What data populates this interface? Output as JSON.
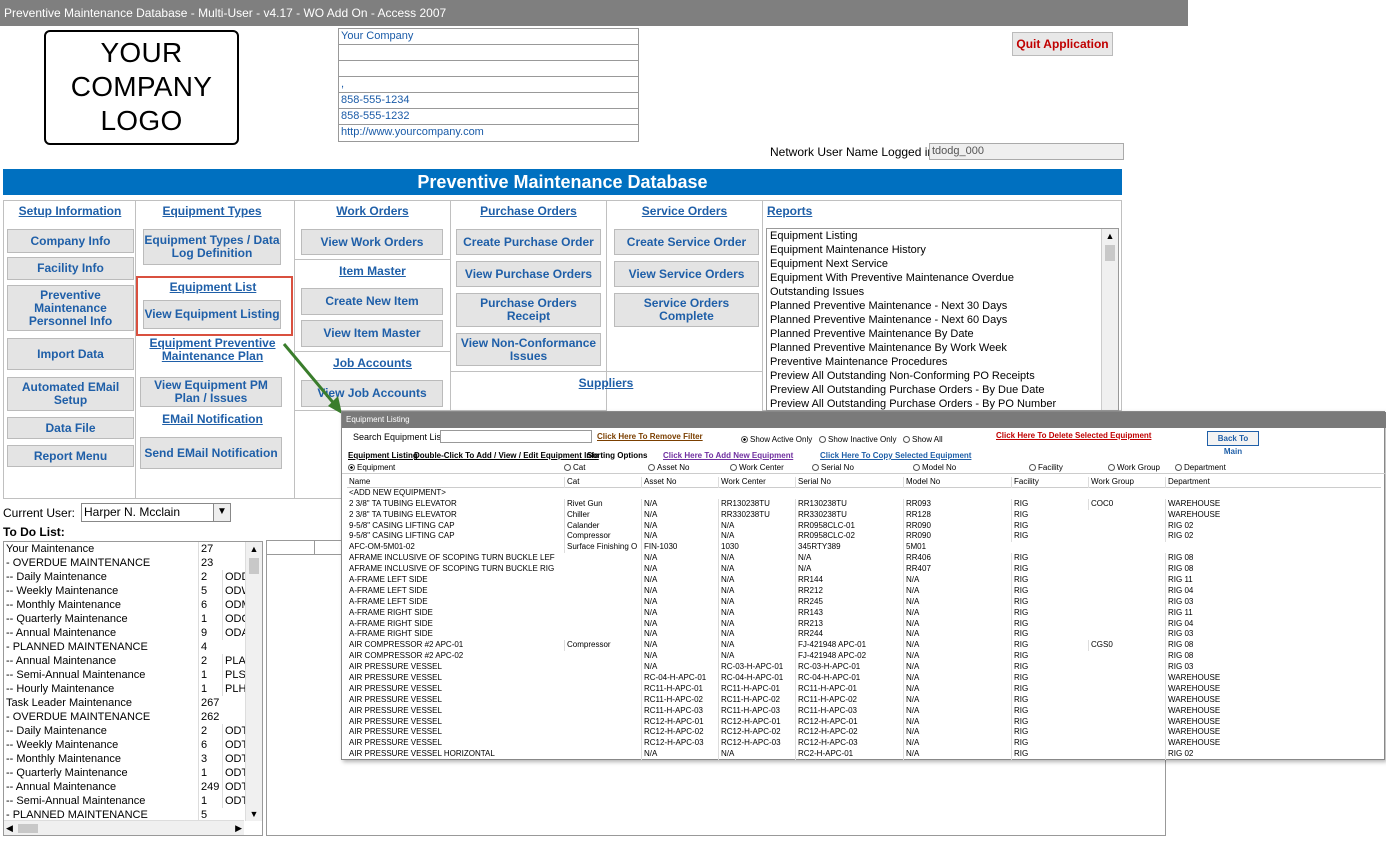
{
  "window_title": "Preventive Maintenance Database - Multi-User - v4.17 - WO Add On - Access 2007",
  "logo": {
    "line1": "YOUR",
    "line2": "COMPANY",
    "line3": "LOGO"
  },
  "company_info": [
    "Your Company",
    "",
    "",
    ",",
    "858-555-1234",
    "858-555-1232",
    "http://www.yourcompany.com"
  ],
  "quit_label": "Quit Application",
  "network_user": {
    "label": "Network User Name Logged in is",
    "value": "tdodg_000"
  },
  "banner": "Preventive Maintenance Database",
  "setup": {
    "header": "Setup Information",
    "buttons": [
      "Company Info",
      "Facility Info",
      "Preventive Maintenance Personnel Info",
      "Import Data",
      "Automated EMail Setup",
      "Data File",
      "Report Menu"
    ]
  },
  "equip_types": {
    "header": "Equipment Types",
    "button": "Equipment Types / Data Log Definition"
  },
  "equip_list": {
    "header": "Equipment List",
    "button": "View Equipment Listing"
  },
  "equip_pm": {
    "header": "Equipment Preventive Maintenance Plan",
    "button": "View Equipment PM Plan / Issues"
  },
  "email_notif": {
    "header": "EMail Notification",
    "button": "Send EMail Notification"
  },
  "work_orders": {
    "header": "Work Orders",
    "button": "View Work Orders"
  },
  "item_master": {
    "header": "Item Master",
    "create": "Create New Item",
    "view": "View Item Master"
  },
  "job_accounts": {
    "header": "Job Accounts",
    "button": "View Job Accounts"
  },
  "purchase_orders": {
    "header": "Purchase Orders",
    "buttons": [
      "Create Purchase Order",
      "View Purchase Orders",
      "Purchase Orders Receipt",
      "View Non-Conformance Issues"
    ]
  },
  "suppliers": {
    "header": "Suppliers"
  },
  "service_orders": {
    "header": "Service Orders",
    "buttons": [
      "Create Service Order",
      "View Service Orders",
      "Service Orders Complete"
    ]
  },
  "reports": {
    "header": "Reports",
    "items": [
      "Equipment Listing",
      "Equipment Maintenance History",
      "Equipment Next Service",
      "Equipment With Preventive Maintenance Overdue",
      "Outstanding Issues",
      "Planned Preventive Maintenance - Next 30 Days",
      "Planned Preventive Maintenance - Next 60 Days",
      "Planned Preventive Maintenance By Date",
      "Planned Preventive Maintenance By Work Week",
      "Preventive Maintenance Procedures",
      "Preview All Outstanding Non-Conforming PO Receipts",
      "Preview All Outstanding Purchase Orders - By Due Date",
      "Preview All Outstanding Purchase Orders - By PO Number"
    ]
  },
  "current_user": {
    "label": "Current User:",
    "value": "Harper N. Mcclain"
  },
  "todo": {
    "label": "To Do List:",
    "rows": [
      [
        "Your Maintenance",
        "27",
        ""
      ],
      [
        " - OVERDUE MAINTENANCE",
        "23",
        ""
      ],
      [
        " -- Daily Maintenance",
        "2",
        "ODD"
      ],
      [
        " -- Weekly Maintenance",
        "5",
        "ODW"
      ],
      [
        " -- Monthly Maintenance",
        "6",
        "ODM"
      ],
      [
        " -- Quarterly Maintenance",
        "1",
        "ODQ"
      ],
      [
        " -- Annual Maintenance",
        "9",
        "ODA"
      ],
      [
        " - PLANNED MAINTENANCE",
        "4",
        ""
      ],
      [
        " -- Annual Maintenance",
        "2",
        "PLAI"
      ],
      [
        " -- Semi-Annual Maintenance",
        "1",
        "PLSe"
      ],
      [
        " -- Hourly Maintenance",
        "1",
        "PLHo"
      ],
      [
        "Task Leader Maintenance",
        "267",
        ""
      ],
      [
        " - OVERDUE MAINTENANCE",
        "262",
        ""
      ],
      [
        " -- Daily Maintenance",
        "2",
        "ODT"
      ],
      [
        " -- Weekly Maintenance",
        "6",
        "ODT"
      ],
      [
        " -- Monthly Maintenance",
        "3",
        "ODT"
      ],
      [
        " -- Quarterly Maintenance",
        "1",
        "ODT"
      ],
      [
        " -- Annual Maintenance",
        "249",
        "ODT"
      ],
      [
        " -- Semi-Annual Maintenance",
        "1",
        "ODT"
      ],
      [
        " - PLANNED MAINTENANCE",
        "5",
        ""
      ]
    ]
  },
  "equipment_window": {
    "title": "Equipment Listing",
    "search_label": "Search Equipment List",
    "remove_filter": "Click Here To Remove Filter",
    "radio_active": "Show Active Only",
    "radio_inactive": "Show Inactive Only",
    "radio_all": "Show All",
    "delete_link": "Click Here To Delete Selected Equipment",
    "back_label": "Back To Main",
    "instructions_a": "Equipment Listing",
    "instructions_b": "Double-Click To Add / View / Edit Equipment Info",
    "sorting_label": "Sorting Options",
    "add_link": "Click Here To Add New Equipment",
    "copy_link": "Click Here To Copy Selected Equipment",
    "sort_options": [
      "Equipment",
      "Cat",
      "Asset No",
      "Work Center",
      "Serial No",
      "Model No",
      "Facility",
      "Work Group",
      "Department"
    ],
    "columns": [
      "Name",
      "Cat",
      "Asset No",
      "Work Center",
      "Serial No",
      "Model No",
      "Facility",
      "Work Group",
      "Department"
    ],
    "rows": [
      [
        "<ADD NEW EQUIPMENT>",
        "",
        "",
        "",
        "",
        "",
        "",
        "",
        ""
      ],
      [
        "2 3/8\" TA TUBING ELEVATOR",
        "Rivet Gun",
        "N/A",
        "RR130238TU",
        "RR130238TU",
        "RR093",
        "RIG",
        "COC0",
        "WAREHOUSE"
      ],
      [
        "2 3/8\" TA TUBING ELEVATOR",
        "Chiller",
        "N/A",
        "RR330238TU",
        "RR330238TU",
        "RR128",
        "RIG",
        "",
        "WAREHOUSE"
      ],
      [
        "9-5/8\" CASING LIFTING CAP",
        "Calander",
        "N/A",
        "N/A",
        "RR0958CLC-01",
        "RR090",
        "RIG",
        "",
        "RIG 02"
      ],
      [
        "9-5/8\" CASING LIFTING CAP",
        "Compressor",
        "N/A",
        "N/A",
        "RR0958CLC-02",
        "RR090",
        "RIG",
        "",
        "RIG 02"
      ],
      [
        "AFC-OM-5M01-02",
        "Surface Finishing O",
        "FIN-1030",
        "1030",
        "345RTY389",
        "5M01",
        "",
        "",
        ""
      ],
      [
        "AFRAME INCLUSIVE OF SCOPING TURN BUCKLE LEF",
        "",
        "N/A",
        "N/A",
        "N/A",
        "RR406",
        "RIG",
        "",
        "RIG 08"
      ],
      [
        "AFRAME INCLUSIVE OF SCOPING TURN BUCKLE RIG",
        "",
        "N/A",
        "N/A",
        "N/A",
        "RR407",
        "RIG",
        "",
        "RIG 08"
      ],
      [
        "A-FRAME LEFT SIDE",
        "",
        "N/A",
        "N/A",
        "RR144",
        "N/A",
        "RIG",
        "",
        "RIG 11"
      ],
      [
        "A-FRAME LEFT SIDE",
        "",
        "N/A",
        "N/A",
        "RR212",
        "N/A",
        "RIG",
        "",
        "RIG 04"
      ],
      [
        "A-FRAME LEFT SIDE",
        "",
        "N/A",
        "N/A",
        "RR245",
        "N/A",
        "RIG",
        "",
        "RIG 03"
      ],
      [
        "A-FRAME RIGHT SIDE",
        "",
        "N/A",
        "N/A",
        "RR143",
        "N/A",
        "RIG",
        "",
        "RIG 11"
      ],
      [
        "A-FRAME RIGHT SIDE",
        "",
        "N/A",
        "N/A",
        "RR213",
        "N/A",
        "RIG",
        "",
        "RIG 04"
      ],
      [
        "A-FRAME RIGHT SIDE",
        "",
        "N/A",
        "N/A",
        "RR244",
        "N/A",
        "RIG",
        "",
        "RIG 03"
      ],
      [
        "AIR COMPRESSOR #2 APC-01",
        "Compressor",
        "N/A",
        "N/A",
        "FJ-421948 APC-01",
        "N/A",
        "RIG",
        "CGS0",
        "RIG 08"
      ],
      [
        "AIR COMPRESSOR #2 APC-02",
        "",
        "N/A",
        "N/A",
        "FJ-421948 APC-02",
        "N/A",
        "RIG",
        "",
        "RIG 08"
      ],
      [
        "AIR PRESSURE VESSEL",
        "",
        "N/A",
        "RC-03-H-APC-01",
        "RC-03-H-APC-01",
        "N/A",
        "RIG",
        "",
        "RIG 03"
      ],
      [
        "AIR PRESSURE VESSEL",
        "",
        "RC-04-H-APC-01",
        "RC-04-H-APC-01",
        "RC-04-H-APC-01",
        "N/A",
        "RIG",
        "",
        "WAREHOUSE"
      ],
      [
        "AIR PRESSURE VESSEL",
        "",
        "RC11-H-APC-01",
        "RC11-H-APC-01",
        "RC11-H-APC-01",
        "N/A",
        "RIG",
        "",
        "WAREHOUSE"
      ],
      [
        "AIR PRESSURE VESSEL",
        "",
        "RC11-H-APC-02",
        "RC11-H-APC-02",
        "RC11-H-APC-02",
        "N/A",
        "RIG",
        "",
        "WAREHOUSE"
      ],
      [
        "AIR PRESSURE VESSEL",
        "",
        "RC11-H-APC-03",
        "RC11-H-APC-03",
        "RC11-H-APC-03",
        "N/A",
        "RIG",
        "",
        "WAREHOUSE"
      ],
      [
        "AIR PRESSURE VESSEL",
        "",
        "RC12-H-APC-01",
        "RC12-H-APC-01",
        "RC12-H-APC-01",
        "N/A",
        "RIG",
        "",
        "WAREHOUSE"
      ],
      [
        "AIR PRESSURE VESSEL",
        "",
        "RC12-H-APC-02",
        "RC12-H-APC-02",
        "RC12-H-APC-02",
        "N/A",
        "RIG",
        "",
        "WAREHOUSE"
      ],
      [
        "AIR PRESSURE VESSEL",
        "",
        "RC12-H-APC-03",
        "RC12-H-APC-03",
        "RC12-H-APC-03",
        "N/A",
        "RIG",
        "",
        "WAREHOUSE"
      ],
      [
        "AIR PRESSURE VESSEL HORIZONTAL",
        "",
        "N/A",
        "N/A",
        "RC2-H-APC-01",
        "N/A",
        "RIG",
        "",
        "RIG 02"
      ]
    ]
  },
  "colors": {
    "accent": "#0070c0",
    "link": "#1f5fa8",
    "danger": "#c00000",
    "highlight": "#d9503f",
    "arrow": "#3a7d2c"
  }
}
